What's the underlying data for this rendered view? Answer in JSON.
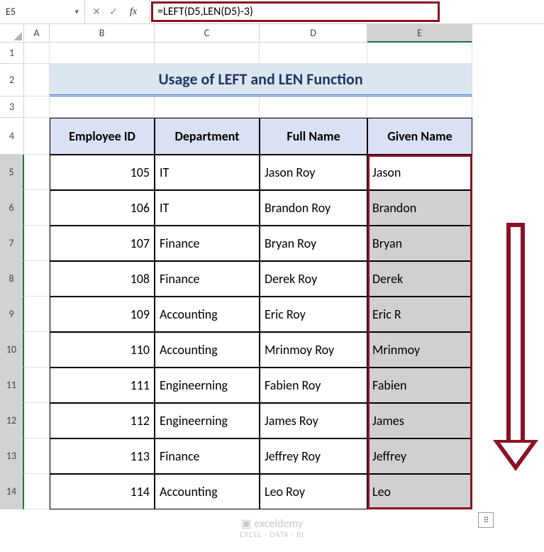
{
  "nameBox": "E5",
  "formula": "=LEFT(D5,LEN(D5)-3)",
  "columns": [
    "A",
    "B",
    "C",
    "D",
    "E"
  ],
  "rows": [
    "1",
    "2",
    "3",
    "4",
    "5",
    "6",
    "7",
    "8",
    "9",
    "10",
    "11",
    "12",
    "13",
    "14"
  ],
  "title": "Usage of LEFT and LEN Function",
  "headers": {
    "empId": "Employee ID",
    "dept": "Department",
    "full": "Full Name",
    "given": "Given Name"
  },
  "data": [
    {
      "id": "105",
      "dept": "IT",
      "full": "Jason Roy",
      "given": "Jason"
    },
    {
      "id": "106",
      "dept": "IT",
      "full": "Brandon Roy",
      "given": "Brandon"
    },
    {
      "id": "107",
      "dept": "Finance",
      "full": "Bryan Roy",
      "given": "Bryan"
    },
    {
      "id": "108",
      "dept": "Finance",
      "full": "Derek Roy",
      "given": "Derek"
    },
    {
      "id": "109",
      "dept": "Accounting",
      "full": "Eric Roy",
      "given": "Eric R"
    },
    {
      "id": "110",
      "dept": "Accounting",
      "full": "Mrinmoy Roy",
      "given": "Mrinmoy"
    },
    {
      "id": "111",
      "dept": "Engineerning",
      "full": "Fabien Roy",
      "given": "Fabien"
    },
    {
      "id": "112",
      "dept": "Engineerning",
      "full": "James Roy",
      "given": "James"
    },
    {
      "id": "113",
      "dept": "Finance",
      "full": "Jeffrey Roy",
      "given": "Jeffrey"
    },
    {
      "id": "114",
      "dept": "Accounting",
      "full": "Leo Roy",
      "given": "Leo"
    }
  ],
  "watermark": {
    "line1": "exceldemy",
    "line2": "EXCEL · DATA · BI"
  }
}
